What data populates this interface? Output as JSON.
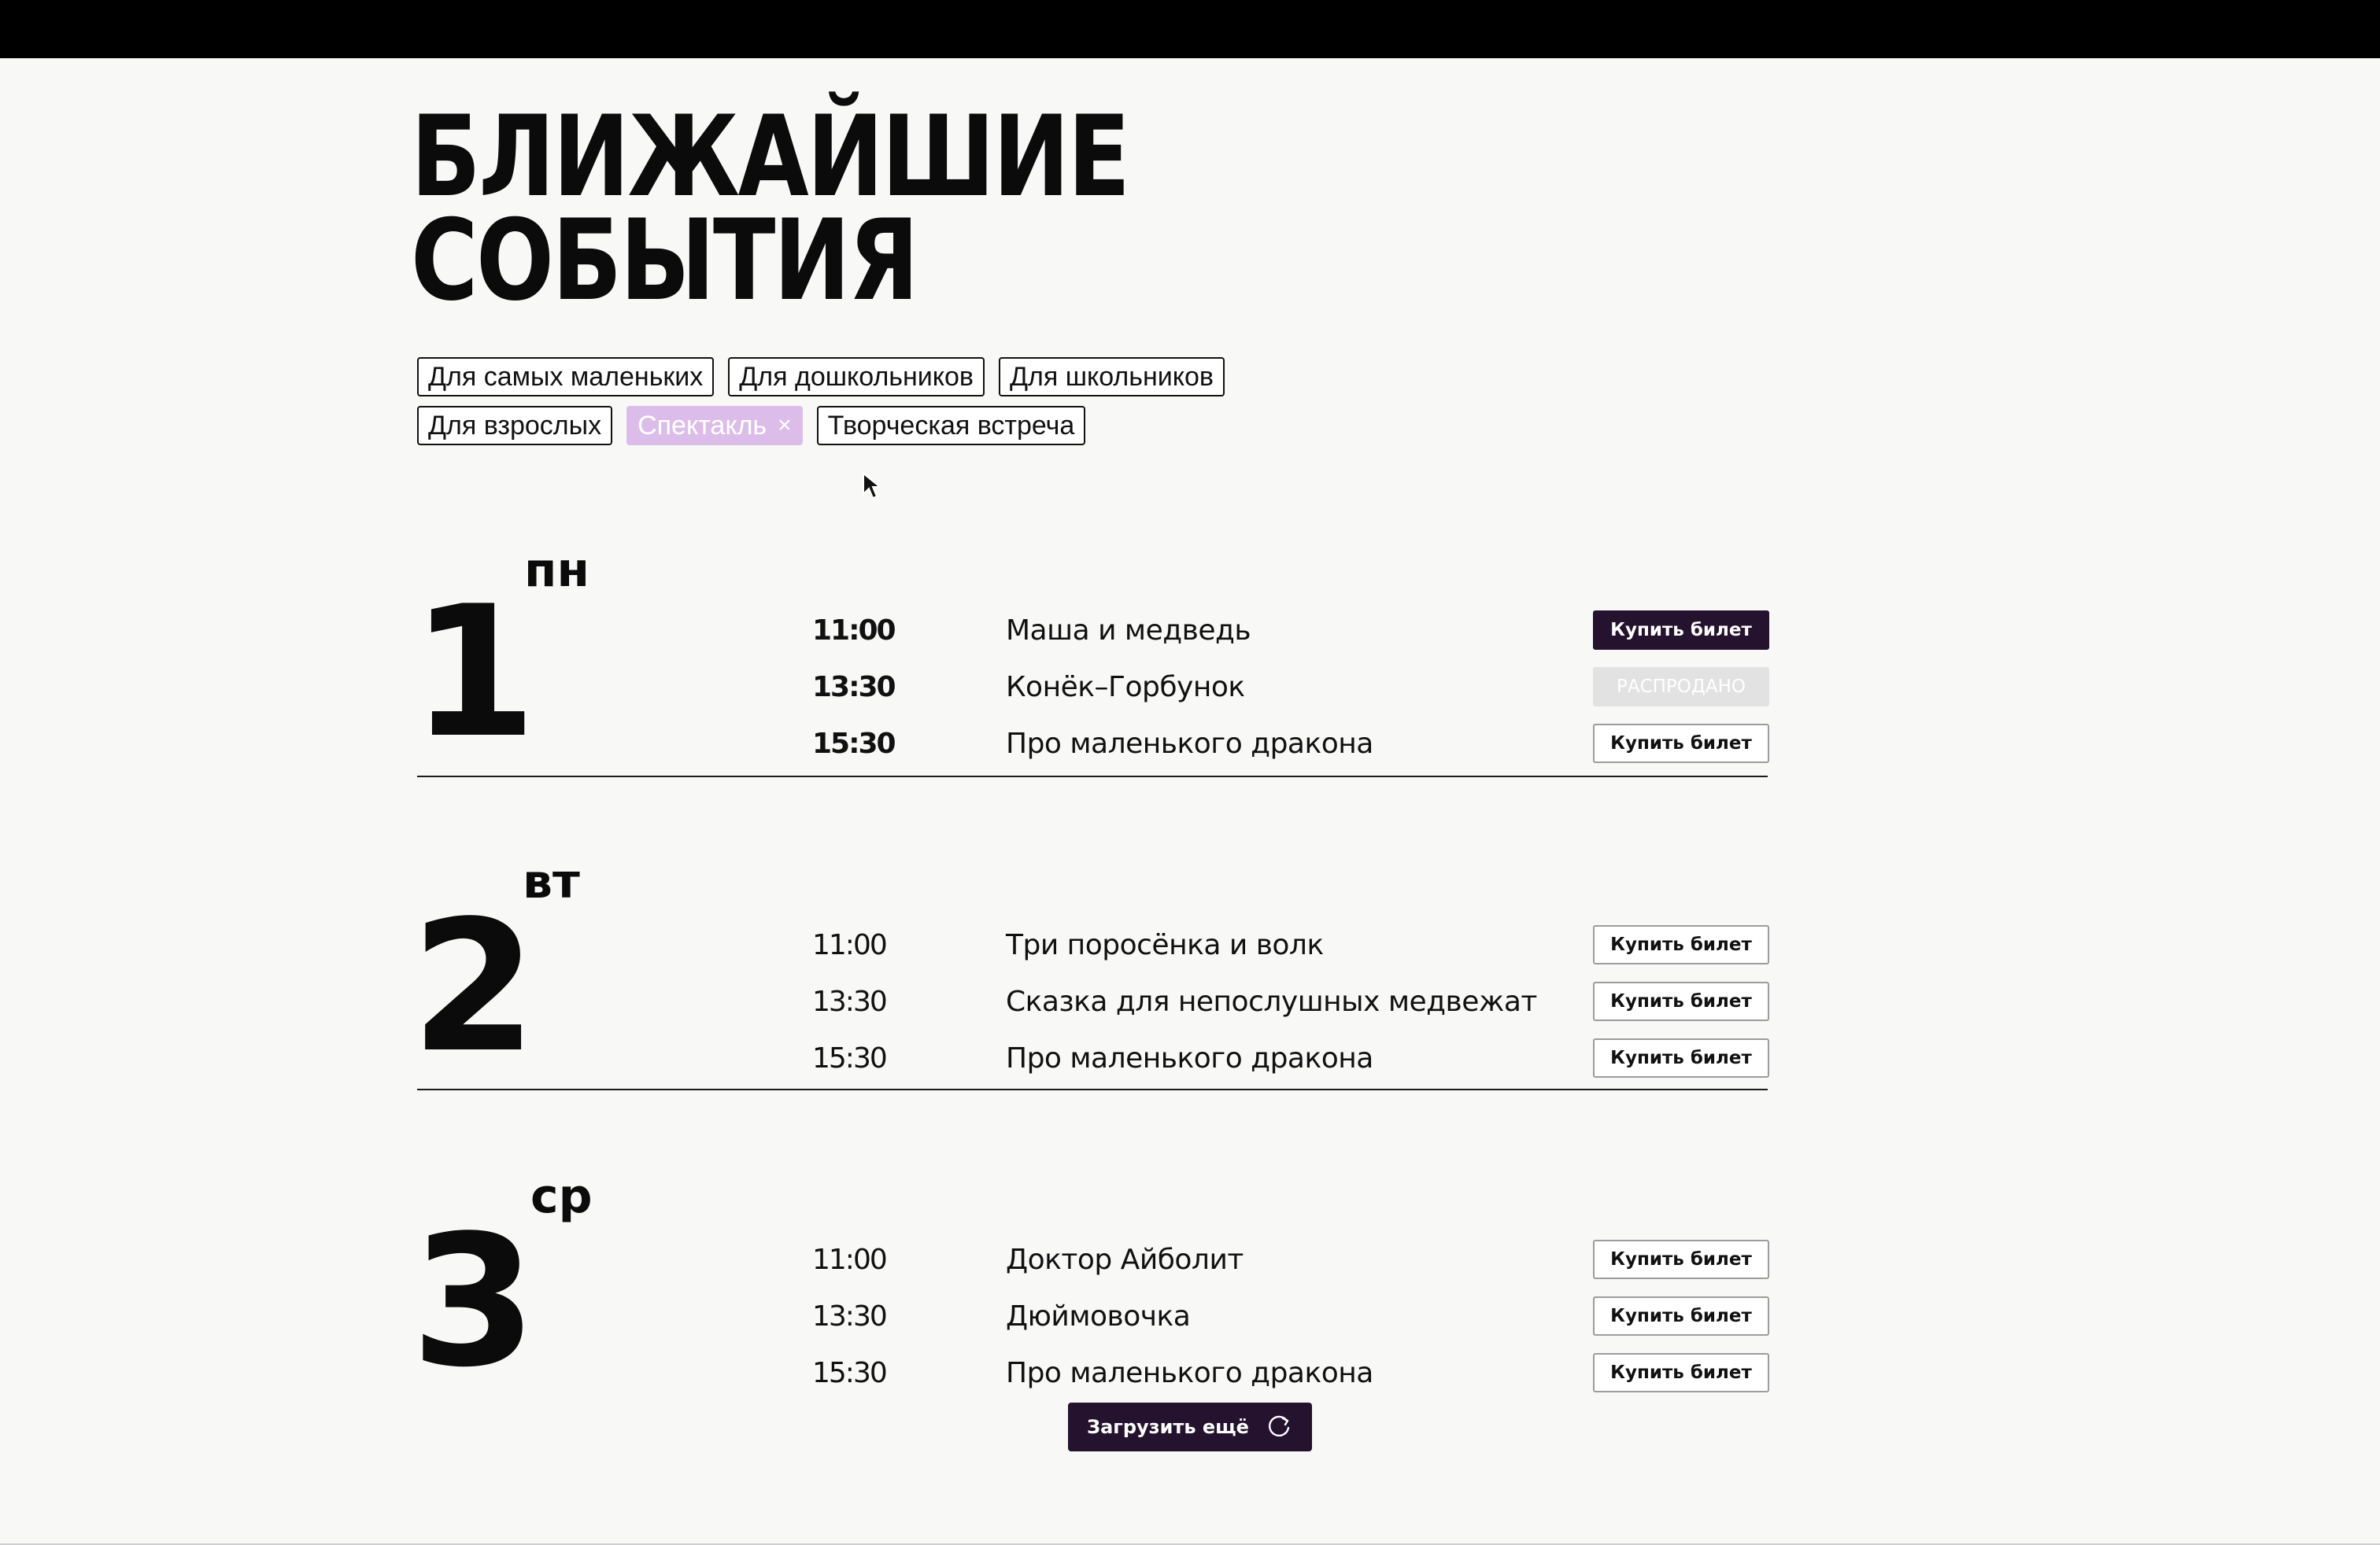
{
  "page": {
    "title_line1": "БЛИЖАЙШИЕ",
    "title_line2": "СОБЫТИЯ"
  },
  "filters": {
    "row1": [
      "Для самых маленьких",
      "Для дошкольников",
      "Для школьников"
    ],
    "row2": [
      "Для взрослых",
      "Спектакль",
      "Творческая встреча"
    ],
    "active": "Спектакль",
    "remove_icon": "×"
  },
  "days": [
    {
      "number": "1",
      "weekday": "пн",
      "events": [
        {
          "time": "11:00",
          "name": "Маша и медведь",
          "button": "Купить билет",
          "state": "primary"
        },
        {
          "time": "13:30",
          "name": "Конёк–Горбунок",
          "button": "РАСПРОДАНО",
          "state": "soldout"
        },
        {
          "time": "15:30",
          "name": "Про маленького дракона",
          "button": "Купить билет",
          "state": "outline"
        }
      ]
    },
    {
      "number": "2",
      "weekday": "вт",
      "events": [
        {
          "time": "11:00",
          "name": "Три поросёнка и волк",
          "button": "Купить билет",
          "state": "outline"
        },
        {
          "time": "13:30",
          "name": "Сказка для непослушных медвежат",
          "button": "Купить билет",
          "state": "outline"
        },
        {
          "time": "15:30",
          "name": "Про маленького дракона",
          "button": "Купить билет",
          "state": "outline"
        }
      ]
    },
    {
      "number": "3",
      "weekday": "ср",
      "events": [
        {
          "time": "11:00",
          "name": "Доктор Айболит",
          "button": "Купить билет",
          "state": "outline"
        },
        {
          "time": "13:30",
          "name": "Дюймовочка",
          "button": "Купить билет",
          "state": "outline"
        },
        {
          "time": "15:30",
          "name": "Про маленького дракона",
          "button": "Купить билет",
          "state": "outline"
        }
      ]
    }
  ],
  "load_more": {
    "label": "Загрузить ещё",
    "icon": "refresh-icon"
  },
  "colors": {
    "accent": "#25122e",
    "active_chip": "#dcbde9",
    "soldout": "#e2e2e2"
  }
}
